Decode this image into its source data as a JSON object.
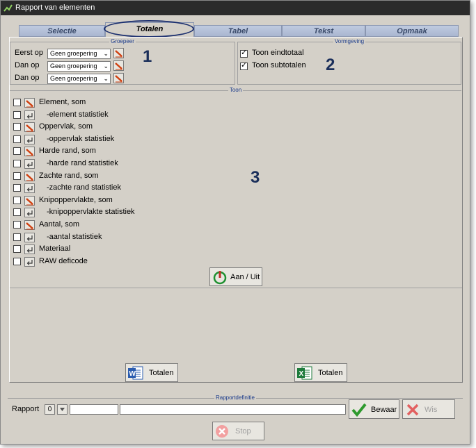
{
  "window": {
    "title": "Rapport van elementen"
  },
  "tabs": [
    {
      "label": "Selectie"
    },
    {
      "label": "Totalen"
    },
    {
      "label": "Tabel"
    },
    {
      "label": "Tekst"
    },
    {
      "label": "Opmaak"
    }
  ],
  "groepeer": {
    "legend": "Groepeer",
    "rows": [
      {
        "label": "Eerst op",
        "value": "Geen groepering"
      },
      {
        "label": "Dan op",
        "value": "Geen groepering"
      },
      {
        "label": "Dan op",
        "value": "Geen groepering"
      }
    ]
  },
  "vormgeving": {
    "legend": "Vormgeving",
    "options": [
      {
        "label": "Toon eindtotaal",
        "checked": true
      },
      {
        "label": "Toon subtotalen",
        "checked": true
      }
    ]
  },
  "toon": {
    "legend": "Toon",
    "items": [
      {
        "label": "Element, som",
        "icon": "pencil-icon"
      },
      {
        "label": "-element statistiek",
        "icon": "return-arrow-icon"
      },
      {
        "label": "Oppervlak, som",
        "icon": "pencil-icon"
      },
      {
        "label": "-oppervlak statistiek",
        "icon": "return-arrow-icon"
      },
      {
        "label": "Harde rand, som",
        "icon": "pencil-icon"
      },
      {
        "label": "-harde rand statistiek",
        "icon": "return-arrow-icon"
      },
      {
        "label": "Zachte rand, som",
        "icon": "pencil-icon"
      },
      {
        "label": "-zachte rand statistiek",
        "icon": "return-arrow-icon"
      },
      {
        "label": "Knipoppervlakte, som",
        "icon": "pencil-icon"
      },
      {
        "label": "-knipoppervlakte statistiek",
        "icon": "return-arrow-icon"
      },
      {
        "label": "Aantal, som",
        "icon": "pencil-icon"
      },
      {
        "label": "-aantal statistiek",
        "icon": "return-arrow-icon"
      },
      {
        "label": "Materiaal",
        "icon": "return-arrow-icon"
      },
      {
        "label": "RAW deficode",
        "icon": "return-arrow-icon"
      }
    ],
    "toggle_label": "Aan / Uit"
  },
  "annotations": {
    "one": "1",
    "two": "2",
    "three": "3"
  },
  "export": {
    "word_label": "Totalen",
    "excel_label": "Totalen"
  },
  "rapportdefinitie": {
    "legend": "Rapportdefinitie",
    "label": "Rapport",
    "small_value": "0",
    "save_label": "Bewaar",
    "delete_label": "Wis"
  },
  "stop_label": "Stop",
  "colors": {
    "accent_tab": "#a9b6d0",
    "annotation": "#1a2e5a",
    "pencil": "#d04010",
    "excel": "#1e7b3c",
    "word": "#2b5caf",
    "power": "#c0302a"
  }
}
